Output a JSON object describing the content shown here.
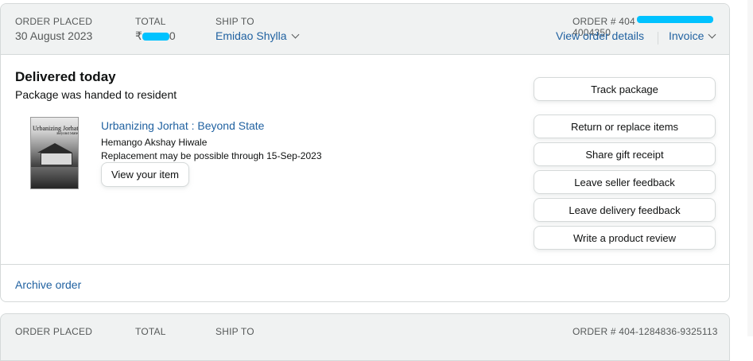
{
  "order": {
    "placed_label": "ORDER PLACED",
    "placed_value": "30 August 2023",
    "total_label": "TOTAL",
    "total_prefix": "₹",
    "total_suffix": "0",
    "ship_to_label": "SHIP TO",
    "ship_to_value": "Emidao Shylla",
    "order_number_prefix": "ORDER # 404",
    "order_number_tail": "4004350",
    "view_details_label": "View order details",
    "invoice_label": "Invoice",
    "status_title": "Delivered today",
    "status_subtitle": "Package was handed to resident",
    "item": {
      "title": "Urbanizing Jorhat : Beyond State",
      "author": "Hemango Akshay Hiwale",
      "replacement_note": "Replacement may be possible through 15-Sep-2023",
      "view_item_label": "View your item",
      "cover_title": "Urbanizing Jorhat",
      "cover_subtitle": "Beyond State"
    },
    "actions": [
      "Track package",
      "Return or replace items",
      "Share gift receipt",
      "Leave seller feedback",
      "Leave delivery feedback",
      "Write a product review"
    ],
    "archive_label": "Archive order"
  },
  "next_order": {
    "placed_label": "ORDER PLACED",
    "total_label": "TOTAL",
    "ship_to_label": "SHIP TO",
    "order_number": "ORDER # 404-1284836-9325113"
  },
  "colors": {
    "link": "#2162a1",
    "header_bg": "#f0f2f2",
    "border": "#d5d9d9",
    "redaction": "#00c2ff"
  },
  "icons": {
    "ship_to_dropdown": "chevron-down-icon",
    "invoice_dropdown": "chevron-down-icon"
  }
}
